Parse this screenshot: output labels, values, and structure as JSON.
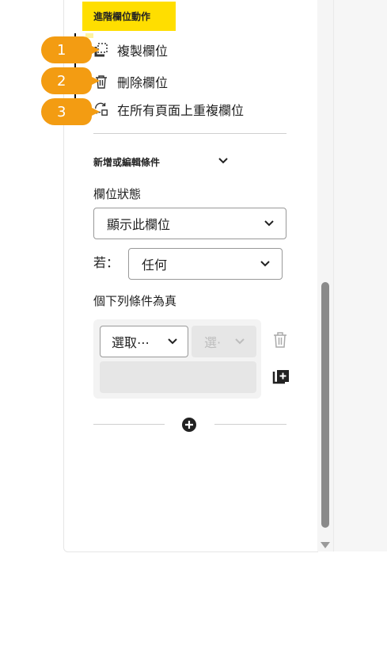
{
  "header": {
    "title": "進階欄位動作"
  },
  "menu": {
    "items": [
      {
        "label": "複製欄位",
        "icon": "duplicate-icon",
        "callout": "1"
      },
      {
        "label": "刪除欄位",
        "icon": "trash-icon",
        "callout": "2"
      },
      {
        "label": "在所有頁面上重複欄位",
        "icon": "repeat-icon",
        "callout": "3"
      }
    ]
  },
  "conditions": {
    "section_title": "新增或編輯條件",
    "field_state_label": "欄位狀態",
    "field_state_value": "顯示此欄位",
    "if_label": "若：",
    "if_value": "任何",
    "condition_text": "個下列條件為真",
    "select_placeholder": "選取⋯",
    "disabled_select_text": "選·"
  },
  "colors": {
    "accent": "#ffde00",
    "callout": "#f39c12"
  }
}
